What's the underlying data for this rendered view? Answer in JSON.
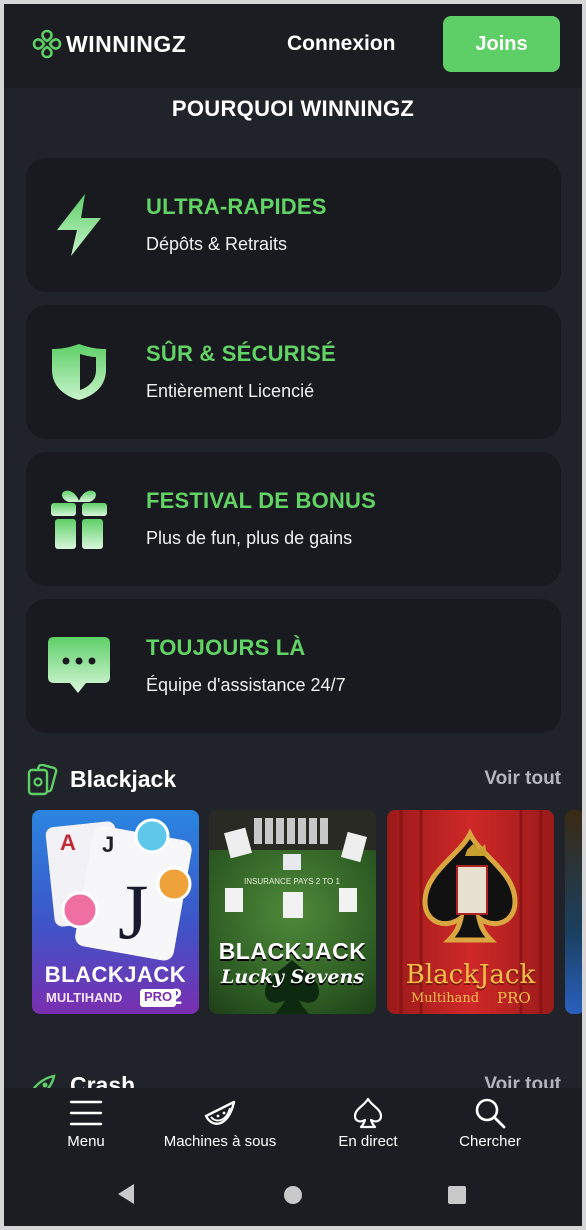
{
  "header": {
    "brand": "WINNINGZ",
    "login_label": "Connexion",
    "join_label": "Joins",
    "accent_color": "#5ecf67"
  },
  "why": {
    "title": "POURQUOI WINNINGZ",
    "features": [
      {
        "title": "ULTRA-RAPIDES",
        "subtitle": "Dépôts & Retraits",
        "icon": "lightning-icon"
      },
      {
        "title": "SÛR & SÉCURISÉ",
        "subtitle": "Entièrement Licencié",
        "icon": "shield-icon"
      },
      {
        "title": "FESTIVAL DE BONUS",
        "subtitle": "Plus de fun, plus de gains",
        "icon": "gift-icon"
      },
      {
        "title": "TOUJOURS LÀ",
        "subtitle": "Équipe d'assistance 24/7",
        "icon": "chat-bubble-icon"
      }
    ]
  },
  "blackjack": {
    "title": "Blackjack",
    "see_all": "Voir tout",
    "games": [
      {
        "line1": "BLACKJACK",
        "line2": "MULTIHAND",
        "badge": "PRO",
        "badge_num": "2"
      },
      {
        "line1": "BLACKJACK",
        "line2": "Lucky Sevens",
        "table_text": "INSURANCE PAYS 2 TO 1"
      },
      {
        "line1": "BlackJack",
        "line2": "Multihand",
        "badge": "PRO"
      }
    ]
  },
  "crash": {
    "title": "Crash",
    "see_all": "Voir tout"
  },
  "bottom_nav": {
    "menu": "Menu",
    "slots": "Machines à sous",
    "live": "En direct",
    "search": "Chercher"
  }
}
